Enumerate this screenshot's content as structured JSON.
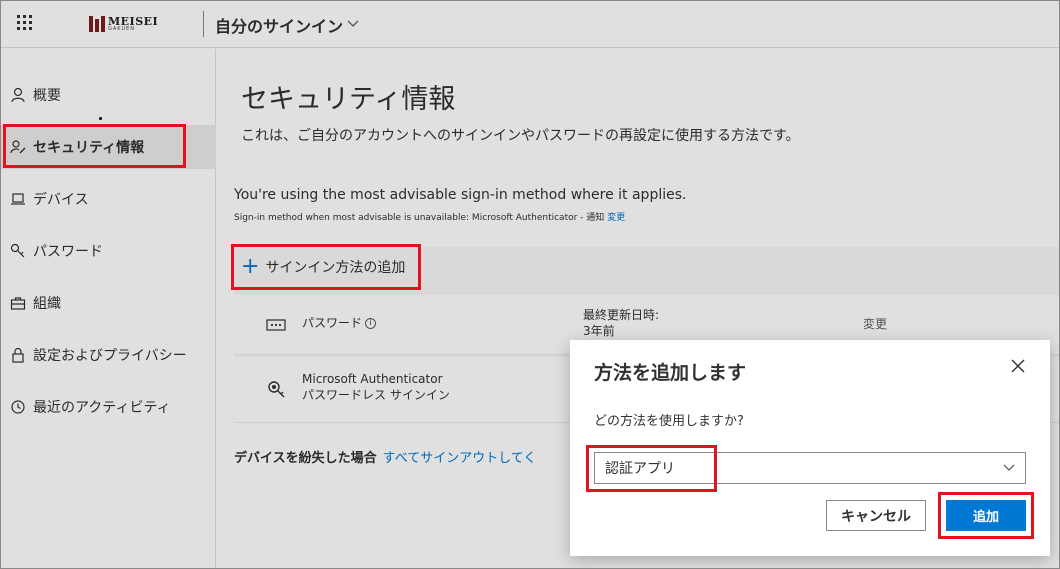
{
  "header": {
    "logo_main": "MEISEI",
    "logo_sub": "GAKUEN",
    "app_title": "自分のサインイン"
  },
  "sidebar": {
    "items": [
      {
        "label": "概要",
        "icon": "person-icon"
      },
      {
        "label": "セキュリティ情報",
        "icon": "security-info-icon"
      },
      {
        "label": "デバイス",
        "icon": "laptop-icon"
      },
      {
        "label": "パスワード",
        "icon": "key-icon"
      },
      {
        "label": "組織",
        "icon": "briefcase-icon"
      },
      {
        "label": "設定およびプライバシー",
        "icon": "lock-icon"
      },
      {
        "label": "最近のアクティビティ",
        "icon": "history-icon"
      }
    ]
  },
  "main": {
    "title": "セキュリティ情報",
    "description": "これは、ご自分のアカウントへのサインインやパスワードの再設定に使用する方法です。",
    "advisable": "You're using the most advisable sign-in method where it applies.",
    "advisable_sub": "Sign-in method when most advisable is unavailable: Microsoft Authenticator - 通知",
    "advisable_change": "変更",
    "add_method": "サインイン方法の追加",
    "methods": [
      {
        "name": "パスワード",
        "meta_label": "最終更新日時:",
        "meta_value": "3年前",
        "action": "変更",
        "icon": "password-dots-icon"
      },
      {
        "name": "Microsoft Authenticator",
        "sub": "パスワードレス サインイン",
        "icon": "authenticator-icon"
      }
    ],
    "lost_device_label": "デバイスを紛失した場合",
    "lost_device_link": "すべてサインアウトしてく"
  },
  "dialog": {
    "title": "方法を追加します",
    "question": "どの方法を使用しますか?",
    "selected": "認証アプリ",
    "cancel": "キャンセル",
    "add": "追加"
  },
  "colors": {
    "accent": "#0078d4",
    "highlight": "#e3121f"
  }
}
